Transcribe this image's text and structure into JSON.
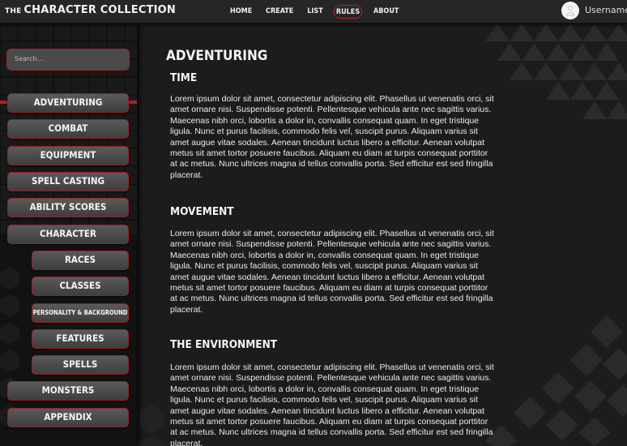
{
  "brand": {
    "prefix": "THE",
    "name": "CHARACTER COLLECTION"
  },
  "nav": [
    {
      "label": "HOME",
      "active": false
    },
    {
      "label": "CREATE",
      "active": false
    },
    {
      "label": "LIST",
      "active": false
    },
    {
      "label": "RULES",
      "active": true
    },
    {
      "label": "ABOUT",
      "active": false
    }
  ],
  "user": {
    "name": "Username",
    "icon": "user-icon"
  },
  "search": {
    "placeholder": "Search..."
  },
  "sidebar": {
    "items": [
      {
        "label": "ADVENTURING"
      },
      {
        "label": "COMBAT"
      },
      {
        "label": "EQUIPMENT"
      },
      {
        "label": "SPELL CASTING"
      },
      {
        "label": "ABILITY SCORES"
      },
      {
        "label": "CHARACTER"
      },
      {
        "label": "RACES"
      },
      {
        "label": "CLASSES"
      },
      {
        "label": "PERSONALITY & BACKGROUND"
      },
      {
        "label": "FEATURES"
      },
      {
        "label": "SPELLS"
      },
      {
        "label": "MONSTERS"
      },
      {
        "label": "APPENDIX"
      }
    ]
  },
  "main": {
    "title": "ADVENTURING",
    "sections": [
      {
        "heading": "TIME",
        "body": "Lorem ipsum dolor sit amet, consectetur adipiscing elit. Phasellus ut  venenatis orci, sit amet ornare nisi. Suspendisse potenti. Pellentesque  vehicula ante nec sagittis varius. Maecenas nibh orci, lobortis a dolor  in, convallis consequat quam. In eget tristique ligula. Nunc et purus  facilisis, commodo felis vel, suscipit purus. Aliquam varius sit amet augue vitae sodales. Aenean tincidunt luctus libero a efficitur. Aenean  volutpat metus sit amet tortor posuere faucibus. Aliquam eu diam at  turpis consequat porttitor at ac metus. Nunc ultrices magna id tellus  convallis porta. Sed efficitur est sed fringilla placerat."
      },
      {
        "heading": "MOVEMENT",
        "body": "Lorem ipsum dolor sit amet, consectetur adipiscing elit. Phasellus ut  venenatis orci, sit amet ornare nisi. Suspendisse potenti. Pellentesque  vehicula ante nec sagittis varius. Maecenas nibh orci, lobortis a dolor  in, convallis consequat quam. In eget tristique ligula. Nunc et purus  facilisis, commodo felis vel, suscipit purus. Aliquam varius sit amet augue vitae sodales. Aenean tincidunt luctus libero a efficitur. Aenean  volutpat metus sit amet tortor posuere faucibus. Aliquam eu diam at  turpis consequat porttitor at ac metus. Nunc ultrices magna id tellus  convallis porta. Sed efficitur est sed fringilla placerat."
      },
      {
        "heading": "THE ENVIRONMENT",
        "body": "Lorem ipsum dolor sit amet, consectetur adipiscing elit. Phasellus ut  venenatis orci, sit amet ornare nisi. Suspendisse potenti. Pellentesque  vehicula ante nec sagittis varius. Maecenas nibh orci, lobortis a dolor  in, convallis consequat quam. In eget tristique ligula. Nunc et purus  facilisis, commodo felis vel, suscipit purus. Aliquam varius sit amet augue vitae sodales. Aenean tincidunt luctus libero a efficitur. Aenean  volutpat metus sit amet tortor posuere faucibus. Aliquam eu diam at  turpis consequat porttitor at ac metus. Nunc ultrices magna id tellus  convallis porta. Sed efficitur est sed fringilla placerat."
      }
    ]
  },
  "colors": {
    "accent": "#b01f26",
    "button": "#4a4a4a",
    "background": "#1c1c1c"
  }
}
